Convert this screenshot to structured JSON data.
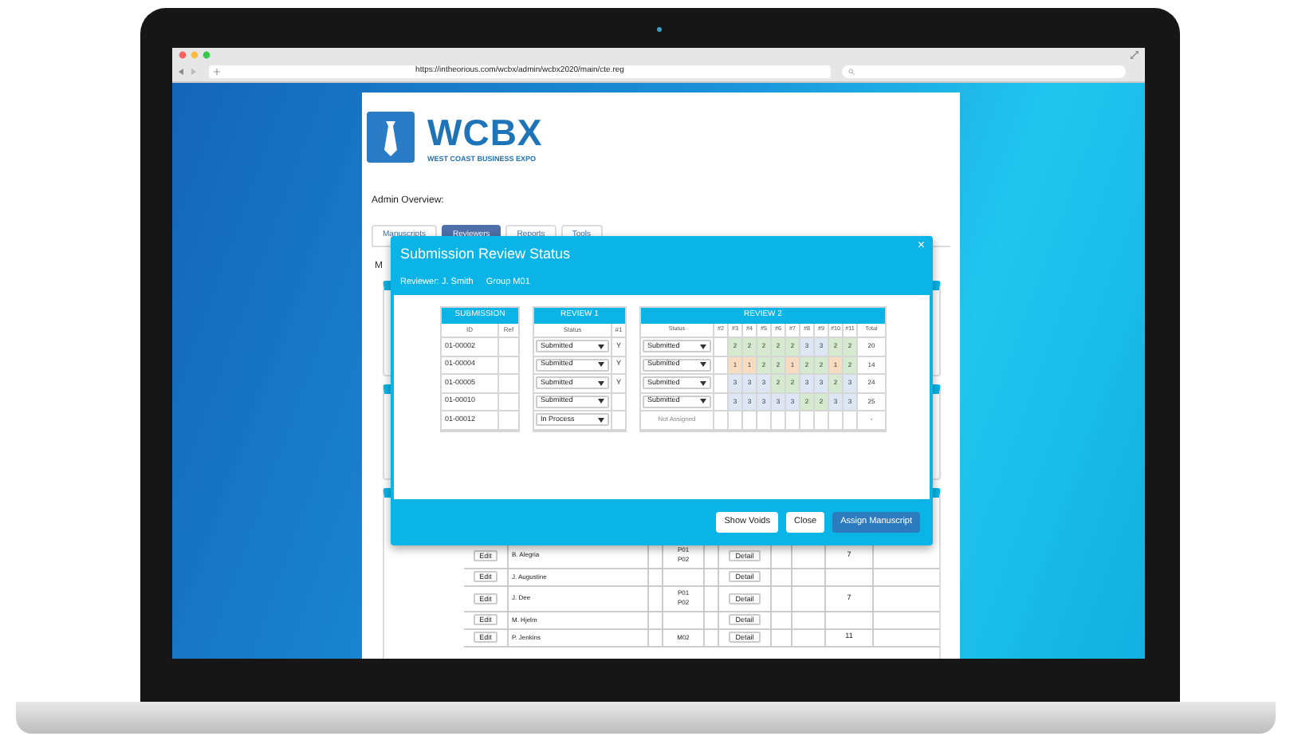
{
  "browser": {
    "url": "https://intheorious.com/wcbx/admin/wcbx2020/main/cte.reg"
  },
  "logo": {
    "title": "WCBX",
    "subtitle": "WEST COAST BUSINESS EXPO"
  },
  "page_heading": "Admin Overview:",
  "tabs": [
    {
      "label": "Manuscripts",
      "selected": false
    },
    {
      "label": "Reviewers",
      "selected": true
    },
    {
      "label": "Reports",
      "selected": false
    },
    {
      "label": "Tools",
      "selected": false
    }
  ],
  "section_heading": "M",
  "modal": {
    "title": "Submission Review Status",
    "reviewer_label": "Reviewer:",
    "reviewer": "J. Smith",
    "group": "Group M01",
    "close": "×",
    "submission": {
      "title": "SUBMISSION",
      "columns": [
        "ID",
        "Ref"
      ],
      "rows": [
        {
          "id": "01-00002"
        },
        {
          "id": "01-00004"
        },
        {
          "id": "01-00005"
        },
        {
          "id": "01-00010"
        },
        {
          "id": "01-00012"
        }
      ]
    },
    "review_1": {
      "title": "REVIEW 1",
      "columns": [
        "Status",
        "#1"
      ],
      "rows": [
        {
          "status": "Submitted",
          "mark": "Y"
        },
        {
          "status": "Submitted",
          "mark": "Y"
        },
        {
          "status": "Submitted",
          "mark": "Y"
        },
        {
          "status": "Submitted"
        },
        {
          "status": "In Process"
        }
      ]
    },
    "review_2": {
      "title": "REVIEW 2",
      "columns": [
        "Status",
        "#2",
        "#3",
        "#4",
        "#5",
        "#6",
        "#7",
        "#8",
        "#9",
        "#10",
        "#11",
        "Total"
      ],
      "rows": [
        {
          "kind": "dropdown",
          "status": "Submitted",
          "scores": [
            {
              "value": "2",
              "color": "#d6ead0"
            },
            {
              "value": "2",
              "color": "#d6ead0"
            },
            {
              "value": "2",
              "color": "#d6ead0"
            },
            {
              "value": "2",
              "color": "#d6ead0"
            },
            {
              "value": "2",
              "color": "#d6ead0"
            },
            {
              "value": "3",
              "color": "#dde6f4"
            },
            {
              "value": "3",
              "color": "#dde6f4"
            },
            {
              "value": "2",
              "color": "#d6ead0"
            },
            {
              "value": "2",
              "color": "#d6ead0"
            }
          ],
          "total": "20"
        },
        {
          "kind": "dropdown",
          "status": "Submitted",
          "scores": [
            {
              "value": "1",
              "color": "#f8dcc0"
            },
            {
              "value": "1",
              "color": "#f8dcc0"
            },
            {
              "value": "2",
              "color": "#d6ead0"
            },
            {
              "value": "2",
              "color": "#d6ead0"
            },
            {
              "value": "1",
              "color": "#f8dcc0"
            },
            {
              "value": "2",
              "color": "#d6ead0"
            },
            {
              "value": "2",
              "color": "#d6ead0"
            },
            {
              "value": "1",
              "color": "#f8dcc0"
            },
            {
              "value": "2",
              "color": "#d6ead0"
            }
          ],
          "total": "14"
        },
        {
          "kind": "dropdown",
          "status": "Submitted",
          "scores": [
            {
              "value": "3",
              "color": "#dde6f4"
            },
            {
              "value": "3",
              "color": "#dde6f4"
            },
            {
              "value": "3",
              "color": "#dde6f4"
            },
            {
              "value": "2",
              "color": "#d6ead0"
            },
            {
              "value": "2",
              "color": "#d6ead0"
            },
            {
              "value": "3",
              "color": "#dde6f4"
            },
            {
              "value": "3",
              "color": "#dde6f4"
            },
            {
              "value": "2",
              "color": "#d6ead0"
            },
            {
              "value": "3",
              "color": "#dde6f4"
            }
          ],
          "total": "24"
        },
        {
          "kind": "dropdown",
          "status": "Submitted",
          "scores": [
            {
              "value": "3",
              "color": "#dde6f4"
            },
            {
              "value": "3",
              "color": "#dde6f4"
            },
            {
              "value": "3",
              "color": "#dde6f4"
            },
            {
              "value": "3",
              "color": "#dde6f4"
            },
            {
              "value": "3",
              "color": "#dde6f4"
            },
            {
              "value": "2",
              "color": "#d6ead0"
            },
            {
              "value": "2",
              "color": "#d6ead0"
            },
            {
              "value": "3",
              "color": "#dde6f4"
            },
            {
              "value": "3",
              "color": "#dde6f4"
            }
          ],
          "total": "25"
        },
        {
          "kind": "text",
          "status": "Not Assigned",
          "total": "-"
        }
      ]
    },
    "buttons": [
      {
        "label": "Show Voids",
        "kind": "default"
      },
      {
        "label": "Close",
        "kind": "default"
      },
      {
        "label": "Assign Manuscript",
        "kind": "primary"
      }
    ]
  },
  "background_table": {
    "rows": [
      {
        "action": "Edit",
        "name": "B. Alegria",
        "codes": [
          "P01",
          "P02"
        ],
        "detail": "Detail",
        "count": "7"
      },
      {
        "action": "Edit",
        "name": "J. Augustine",
        "codes": [],
        "detail": "Detail"
      },
      {
        "action": "Edit",
        "name": "J. Dee",
        "codes": [
          "P01",
          "P02"
        ],
        "detail": "Detail",
        "count": "7"
      },
      {
        "action": "Edit",
        "name": "M. Hjelm",
        "codes": [],
        "detail": "Detail"
      },
      {
        "action": "Edit",
        "name": "P. Jenkins",
        "codes": [
          "M02"
        ],
        "detail": "Detail",
        "count": "11"
      }
    ]
  }
}
